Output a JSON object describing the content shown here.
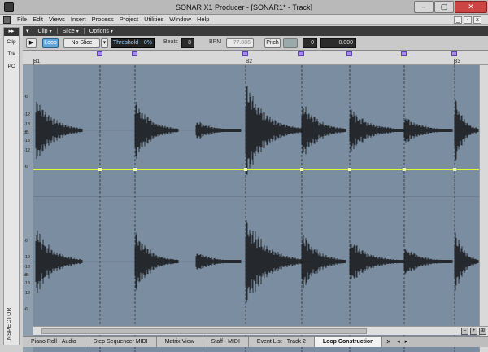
{
  "window": {
    "title": "SONAR X1 Producer - [SONAR1* - Track]"
  },
  "menubar": {
    "items": [
      "File",
      "Edit",
      "Views",
      "Insert",
      "Process",
      "Project",
      "Utilities",
      "Window",
      "Help"
    ]
  },
  "inspector": {
    "collapse": "▸▸",
    "tabs": [
      "Clip",
      "Trk",
      "PC"
    ],
    "label": "INSPECTOR"
  },
  "loop_view": {
    "menus": [
      "Clip",
      "Slice",
      "Options"
    ],
    "toolbar": {
      "play_icon": "▶",
      "loop_label": "Loop",
      "slice_value": "No Slice",
      "threshold_label": "Threshold",
      "threshold_value": "0%",
      "beats_label": "Beats",
      "beats_value": "8",
      "bpm_label": "BPM",
      "bpm_value": "77.886",
      "pitch_label": "Pitch",
      "pitch_semitones": "0",
      "pitch_cents": "0.000"
    },
    "ruler": {
      "bars": [
        "B1",
        "B2",
        "B3"
      ]
    },
    "db_scale": [
      "-6",
      "-12",
      "-18",
      "dB",
      "-18",
      "-12",
      "-6"
    ],
    "tabs": [
      "Piano Roll - Audio",
      "Step Sequencer MIDI",
      "Matrix View",
      "Staff - MIDI",
      "Event List - Track 2",
      "Loop Construction"
    ],
    "active_tab": "Loop Construction",
    "colors": {
      "waveform_bg": "#7b8ea1",
      "waveform": "#111111",
      "threshold_line": "#d9ff33",
      "slice_marker": "#a88af0",
      "loop_button": "#62a6de"
    }
  }
}
